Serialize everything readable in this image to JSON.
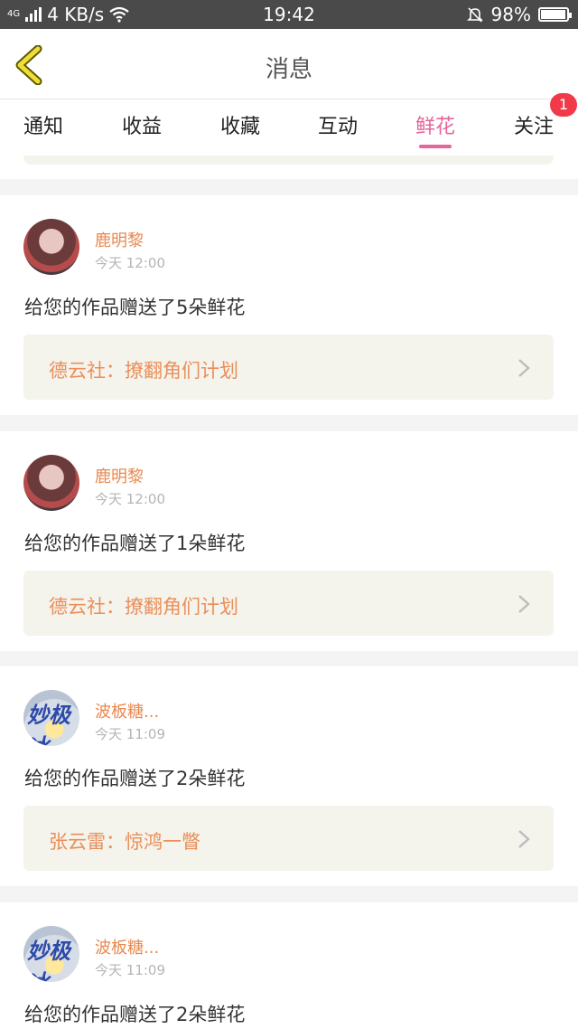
{
  "status_bar": {
    "network": "4G",
    "speed": "4 KB/s",
    "time": "19:42",
    "battery": "98%",
    "battery_level": 0.98,
    "icons": [
      "signal-icon",
      "wifi-icon",
      "silent-bell-icon",
      "battery-icon"
    ]
  },
  "header": {
    "back_icon": "chevron-left-icon",
    "title": "消息"
  },
  "tabs": [
    {
      "label": "通知",
      "active": false
    },
    {
      "label": "收益",
      "active": false
    },
    {
      "label": "收藏",
      "active": false
    },
    {
      "label": "互动",
      "active": false
    },
    {
      "label": "鲜花",
      "active": true
    },
    {
      "label": "关注",
      "active": false,
      "badge": "1"
    }
  ],
  "colors": {
    "accent": "#e4669a",
    "username": "#e8884f",
    "work_link_text": "#ea8f5a",
    "badge": "#f03a4a"
  },
  "messages": [
    {
      "user": "鹿明黎",
      "time": "今天 12:00",
      "text": "给您的作品赠送了5朵鲜花",
      "work": "德云社：撩翻角们计划"
    },
    {
      "user": "鹿明黎",
      "time": "今天 12:00",
      "text": "给您的作品赠送了1朵鲜花",
      "work": "德云社：撩翻角们计划"
    },
    {
      "user": "波板糖...",
      "time": "今天 11:09",
      "text": "给您的作品赠送了2朵鲜花",
      "work": "张云雷：惊鸿一瞥",
      "avatar_text": "妙极冰"
    },
    {
      "user": "波板糖...",
      "time": "今天 11:09",
      "text": "给您的作品赠送了2朵鲜花",
      "avatar_text": "妙极冰"
    }
  ]
}
